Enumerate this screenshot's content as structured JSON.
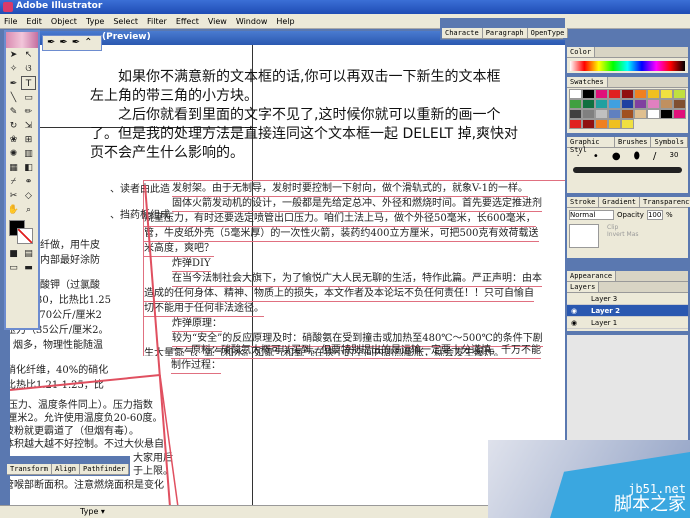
{
  "app": {
    "title": "Adobe Illustrator",
    "doc_title": "(Preview)"
  },
  "menu": [
    "File",
    "Edit",
    "Object",
    "Type",
    "Select",
    "Filter",
    "Effect",
    "View",
    "Window",
    "Help"
  ],
  "character_tabs": [
    "Characte",
    "Paragraph",
    "OpenType"
  ],
  "main_text": [
    "如果你不满意新的文本框的话,你可以再双击一下新生的文本框",
    "左上角的带三角的小方块。",
    "之后你就看到里面的文字不见了,这时候你就可以重新的画一个",
    "了。但是我的处理方法是直接连同这个文本框一起 DELELT 掉,爽快对",
    "页不会产生什么影响的。"
  ],
  "frame_text": [
    "发射架。由于无制导，发射时要控制一下射向，做个滑轨式的，就象V-1的一样。",
    "固体火箭发动机的设计，一般都是先给定总冲、外径和燃烧时间。首先要选定推进剂",
    "烧室压力，有时还要选定喷管出口压力。咱们土法上马，做个外径50毫米，长600毫米，",
    "管，牛皮纸外壳（5毫米厚）的一次性火箭，装药约400立方厘米，可把500克有效荷载送",
    "米高度，爽吧？",
    "炸弹DIY",
    "在当今法制社会大旗下，为了愉悦广大人民无聊的生活，特作此篇。严正声明：由本",
    "造成的任何身体、精神、物质上的损失，本文作者及本论坛不负任何责任！！只可自愉自",
    "切不能用于任何非法途径。",
    "炸弹原理：",
    "较为“安全”的反应原理及时：硝酸氨在受到撞击或加热至480℃～500℃的条件下剧",
    "生大量氮气、氧气和水。如氮气和氧气在狭小的空间内剧烈膨胀，就会发生爆炸。",
    "制作过程：",
    "一、原料：硝酸氨大概可以买到，但要特别提出的是运输一定要十分谨慎，千万不能"
  ],
  "left_text": [
    "、读者由此造",
    "、挡药板组成",
    "纤做，用牛皮",
    "内部最好涂防",
    "酸钾（过氯酸",
    "分子量30，比热比1.25",
    "米/秒（70公斤/厘米2",
    "压力（35公斤/厘米2。",
    "烟多，物理性能随温",
    "硝化纤维，40%的硝化",
    "比热比1.21-1.25，比"
  ],
  "left_text2": [
    "(压力、温度条件同上）。压力指数",
    "/厘米2。允许使用温度负20-60度。",
    "玻粉就更霸道了（但烟有毒）。",
    "体积越大越不好控制。不过大伙悬自",
    "大家用后",
    "于上限。",
    "管喉部断面积。注意燃烧面积是变化"
  ],
  "panels": {
    "color": "Color",
    "swatches": "Swatches",
    "brush_tabs": [
      "Graphic Styl",
      "Brushes",
      "Symbols"
    ],
    "brush_size": "30",
    "transparency_tabs": [
      "Stroke",
      "Gradient",
      "Transparency"
    ],
    "blend_mode": "Normal",
    "opacity_label": "Opacity",
    "opacity": "100",
    "opacity_unit": "%",
    "clip": "Clip",
    "invert": "Invert Mas",
    "appearance": "Appearance",
    "layers": "Layers",
    "layer_items": [
      "Layer 3",
      "Layer 2",
      "Layer 1"
    ]
  },
  "transform_tabs": [
    "Transform",
    "Align",
    "Pathfinder"
  ],
  "status": {
    "tool": "Type"
  },
  "watermark": {
    "url": "jb51.net",
    "name": "脚本之家"
  },
  "swatch_colors": [
    "#fff",
    "#000",
    "#e0107a",
    "#e02020",
    "#901010",
    "#f08020",
    "#f0c020",
    "#f0e040",
    "#c0e040",
    "#40a040",
    "#107040",
    "#20a0a0",
    "#40a0e0",
    "#2040a0",
    "#8040a0",
    "#e080c0",
    "#c09060",
    "#805030",
    "#404040",
    "#808080",
    "#c0c0c0",
    "#6080c0",
    "#a05020",
    "#e0c090"
  ]
}
